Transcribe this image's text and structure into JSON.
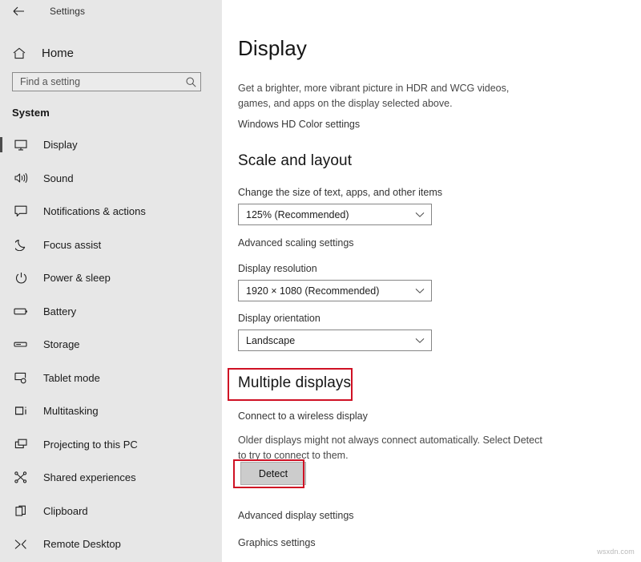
{
  "window": {
    "title": "Settings",
    "back_icon": "back-arrow-icon"
  },
  "sidebar": {
    "home_label": "Home",
    "home_icon": "home-icon",
    "search": {
      "placeholder": "Find a setting",
      "value": "",
      "icon": "search-icon"
    },
    "group_title": "System",
    "items": [
      {
        "label": "Display",
        "icon": "monitor-icon",
        "selected": true
      },
      {
        "label": "Sound",
        "icon": "speaker-icon",
        "selected": false
      },
      {
        "label": "Notifications & actions",
        "icon": "comment-icon",
        "selected": false
      },
      {
        "label": "Focus assist",
        "icon": "moon-icon",
        "selected": false
      },
      {
        "label": "Power & sleep",
        "icon": "power-icon",
        "selected": false
      },
      {
        "label": "Battery",
        "icon": "battery-icon",
        "selected": false
      },
      {
        "label": "Storage",
        "icon": "storage-drive-icon",
        "selected": false
      },
      {
        "label": "Tablet mode",
        "icon": "tablet-icon",
        "selected": false
      },
      {
        "label": "Multitasking",
        "icon": "multitasking-icon",
        "selected": false
      },
      {
        "label": "Projecting to this PC",
        "icon": "projecting-icon",
        "selected": false
      },
      {
        "label": "Shared experiences",
        "icon": "share-nodes-icon",
        "selected": false
      },
      {
        "label": "Clipboard",
        "icon": "clipboard-icon",
        "selected": false
      },
      {
        "label": "Remote Desktop",
        "icon": "remote-desktop-icon",
        "selected": false
      }
    ]
  },
  "main": {
    "page_title": "Display",
    "hdr_description": "Get a brighter, more vibrant picture in HDR and WCG videos, games, and apps on the display selected above.",
    "hd_color_link": "Windows HD Color settings",
    "scale_section": {
      "title": "Scale and layout",
      "scale_label": "Change the size of text, apps, and other items",
      "scale_value": "125% (Recommended)",
      "advanced_scaling_link": "Advanced scaling settings",
      "resolution_label": "Display resolution",
      "resolution_value": "1920 × 1080 (Recommended)",
      "orientation_label": "Display orientation",
      "orientation_value": "Landscape"
    },
    "multiple_displays": {
      "title": "Multiple displays",
      "wireless_link": "Connect to a wireless display",
      "detect_description": "Older displays might not always connect automatically. Select Detect to try to connect to them.",
      "detect_button": "Detect"
    },
    "advanced_display_link": "Advanced display settings",
    "graphics_settings_link": "Graphics settings"
  },
  "annotations": {
    "color": "#cf1124",
    "targets": [
      "multiple-displays-heading",
      "detect-button"
    ]
  },
  "watermark": "wsxdn.com"
}
